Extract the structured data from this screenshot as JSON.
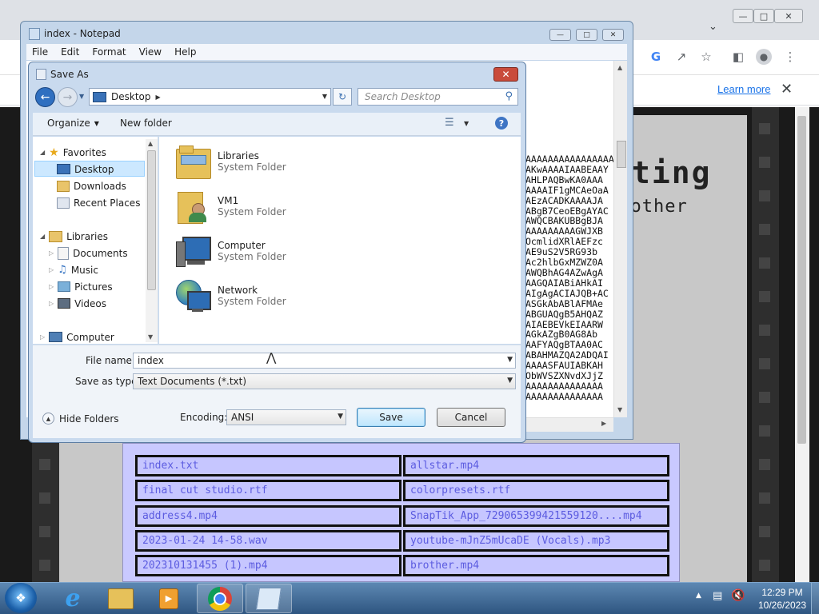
{
  "browser": {
    "infobar_link": "Learn more",
    "page_heading": "ting",
    "page_subheading": "r other",
    "files": [
      [
        "index.txt",
        "allstar.mp4"
      ],
      [
        "final cut studio.rtf",
        "colorpresets.rtf"
      ],
      [
        "address4.mp4",
        "SnapTik_App_729065399421559120....mp4"
      ],
      [
        "2023-01-24 14-58.wav",
        "youtube-mJnZ5mUcaDE (Vocals).mp3"
      ],
      [
        "202310131455 (1).mp4",
        "brother.mp4"
      ]
    ]
  },
  "notepad": {
    "title": "index - Notepad",
    "menu": [
      "File",
      "Edit",
      "Format",
      "View",
      "Help"
    ],
    "text_lines": [
      "AAAAAAAAAAAAAAAA",
      "AKwAAAAIAABEAAY",
      "AHLPAQBwKA0AAA",
      "AAAAIF1gMCAeOaA",
      "AEzACADKAAAAJA",
      "ABgB7CeoEBgAYAC",
      "AWQCBAKUBBgBJA",
      "AAAAAAAAAGWJXB",
      "OcmlidXRlAEFzc",
      "AE9uS2V5RG93b",
      "Ac2hlbGxMZWZ0A",
      "AWQBhAG4AZwAgA",
      "AAGQAIABiAHkAI",
      "AIgAgACIAJQB+AC",
      "ASGkAbABlAFMAe",
      "ABGUAQgB5AHQAZ",
      "AIAEBEVkEIAARW",
      "AGkAZgB0AG8Ab",
      "AAFYAQgBTAA0AC",
      "ABAHMAZQA2ADQAI",
      "AAAASFAUIABKAH",
      "ObWVSZXNvdXJjZ",
      "AAAAAAAAAAAAAA",
      "AAAAAAAAAAAAAA"
    ]
  },
  "dialog": {
    "title": "Save As",
    "location": "Desktop",
    "search_placeholder": "Search Desktop",
    "organize": "Organize",
    "new_folder": "New folder",
    "nav": {
      "favorites": "Favorites",
      "favorites_items": [
        "Desktop",
        "Downloads",
        "Recent Places"
      ],
      "libraries": "Libraries",
      "libraries_items": [
        "Documents",
        "Music",
        "Pictures",
        "Videos"
      ],
      "computer": "Computer"
    },
    "items": [
      {
        "name": "Libraries",
        "type": "System Folder"
      },
      {
        "name": "VM1",
        "type": "System Folder"
      },
      {
        "name": "Computer",
        "type": "System Folder"
      },
      {
        "name": "Network",
        "type": "System Folder"
      }
    ],
    "file_name_label": "File name:",
    "file_name_value": "index",
    "save_type_label": "Save as type:",
    "save_type_value": "Text Documents (*.txt)",
    "hide_folders": "Hide Folders",
    "encoding_label": "Encoding:",
    "encoding_value": "ANSI",
    "save_button": "Save",
    "cancel_button": "Cancel"
  },
  "taskbar": {
    "time": "12:29 PM",
    "date": "10/26/2023"
  }
}
